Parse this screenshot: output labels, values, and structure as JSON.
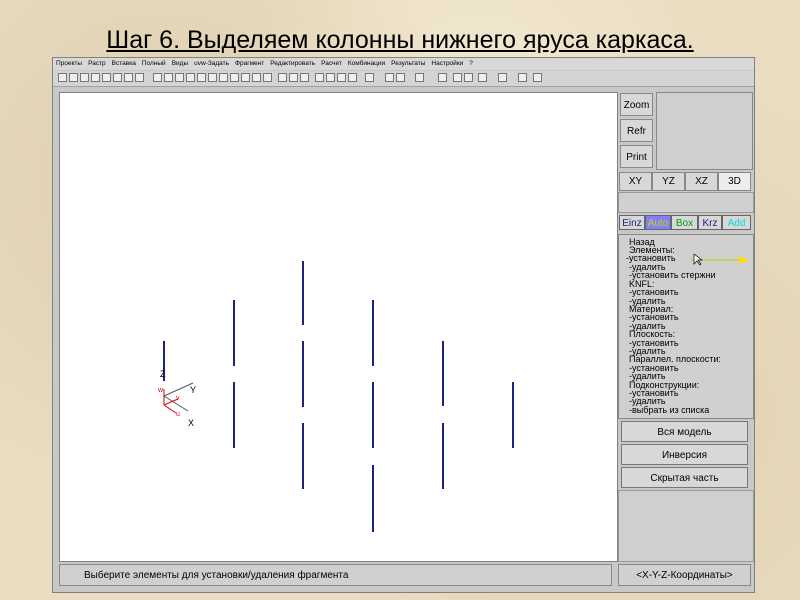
{
  "slide": {
    "title_step": "Шаг 6.",
    "title_rest": " Выделяем колонны нижнего яруса каркаса."
  },
  "menubar": [
    "Проекты",
    "Растр",
    "Вставка",
    "Полный",
    "Виды",
    "uvw-Задать",
    "Фрагмент",
    "Редактировать",
    "Расчет",
    "Комбинации",
    "Результаты",
    "Настройки",
    "?"
  ],
  "side_buttons": {
    "zoom": "Zoom",
    "refr": "Refr",
    "print": "Print"
  },
  "view_tabs": [
    "XY",
    "YZ",
    "XZ",
    "3D"
  ],
  "active_view": "3D",
  "mode_tabs": [
    {
      "label": "Einz",
      "color": "#1a237e"
    },
    {
      "label": "Auto",
      "color": "#e0e000"
    },
    {
      "label": "Box",
      "color": "#00c000"
    },
    {
      "label": "Krz",
      "color": "#1a237e"
    },
    {
      "label": "Add",
      "color": "#00e0e0"
    }
  ],
  "command_list": [
    "Назад",
    "Элементы:",
    "-установить",
    "-удалить",
    "-установить стержни",
    "KNFL:",
    "-установить",
    "-удалить",
    "Материал:",
    "-установить",
    "-удалить",
    "Плоскость:",
    "-установить",
    "-удалить",
    "Параллел. плоскости:",
    "-установить",
    "-удалить",
    "Подконструкции:",
    "-установить",
    "-удалить",
    "-выбрать из списка"
  ],
  "big_buttons": {
    "whole_model": "Вся модель",
    "inversion": "Инверсия",
    "hidden_part": "Скрытая часть"
  },
  "axes": {
    "z": "Z",
    "y": "Y",
    "x": "X",
    "w": "w",
    "v": "v",
    "u": "u"
  },
  "status": {
    "hint": "Выберите элементы для установки/удаления фрагмента",
    "coords": "<X-Y-Z-Координаты>"
  }
}
